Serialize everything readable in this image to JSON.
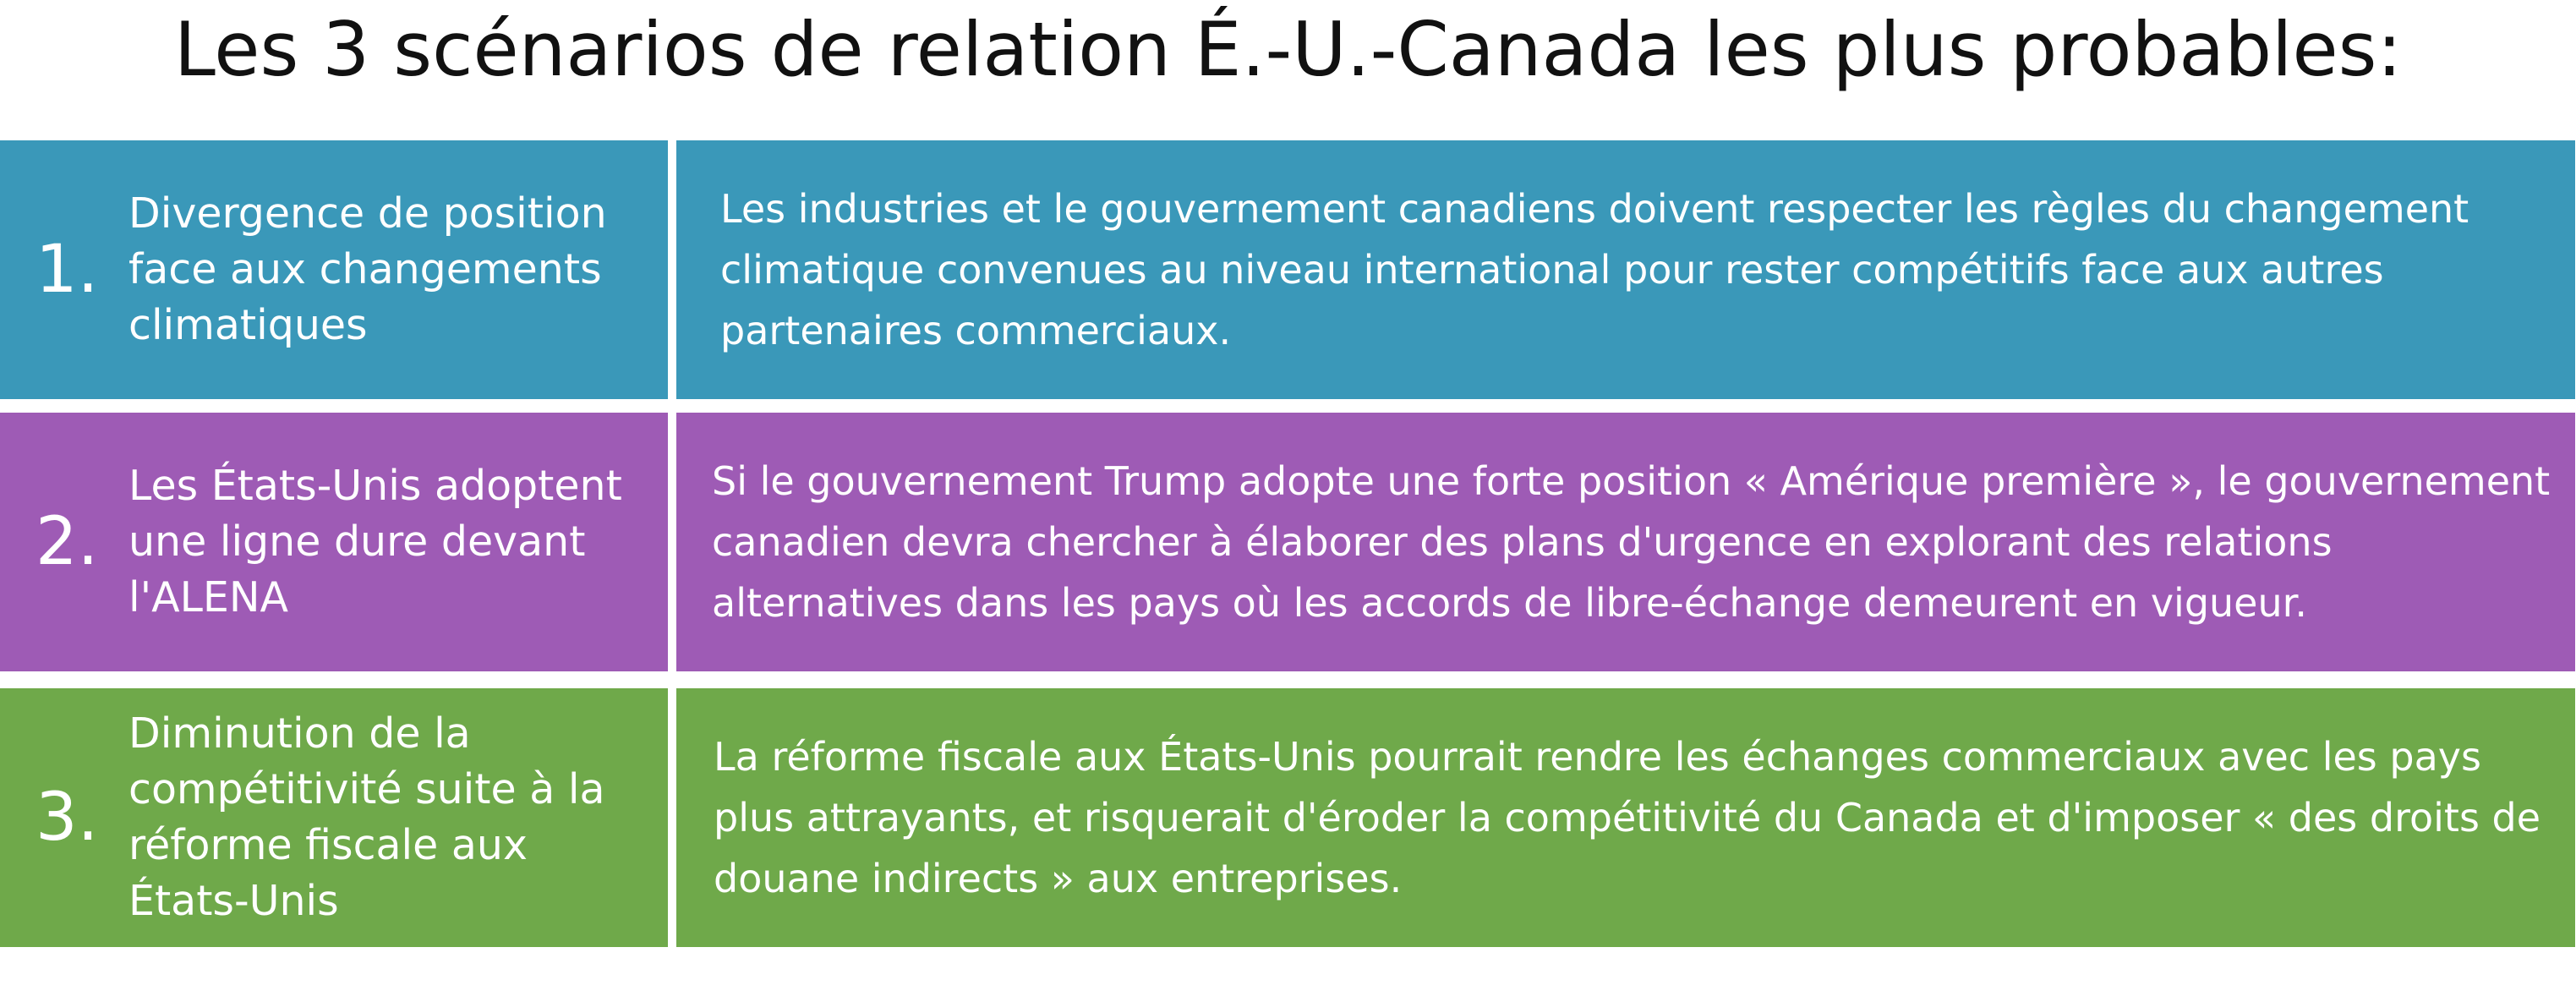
{
  "title": "Les 3 scénarios de relation É.-U.-Canada les plus probables:",
  "colors": {
    "row1": "#3a98b9",
    "row2": "#9e5bb5",
    "row3": "#6fa94a",
    "text": "#ffffff"
  },
  "scenarios": [
    {
      "number": "1.",
      "heading": "Divergence de position face aux changements climatiques",
      "description": "Les industries et le gouvernement canadiens doivent respecter les règles du changement climatique convenues au niveau international pour rester compétitifs face aux autres partenaires commerciaux."
    },
    {
      "number": "2.",
      "heading": "Les États-Unis adoptent une ligne dure devant l'ALENA",
      "description": "Si le gouvernement Trump adopte une forte position « Amérique première », le gouvernement canadien devra chercher à élaborer des plans d'urgence en explorant des relations alternatives dans les pays où les accords de libre-échange demeurent en vigueur."
    },
    {
      "number": "3.",
      "heading": "Diminution de la compétitivité suite à la réforme fiscale aux États-Unis",
      "description": "La réforme fiscale aux États-Unis pourrait rendre les échanges commerciaux avec les pays plus attrayants, et risquerait d'éroder la compétitivité du Canada et d'imposer « des droits de douane indirects » aux entreprises."
    }
  ]
}
